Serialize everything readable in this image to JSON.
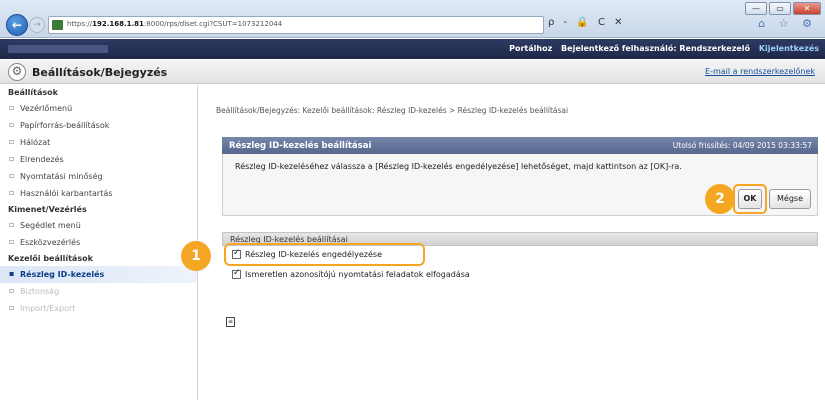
{
  "browser": {
    "url_prefix": "https://",
    "url_host": "192.168.1.81",
    "url_rest": ":8000/rps/dlset.cgi?CSUT=1073212044",
    "search_tools": "ρ - 🔒 C ✕",
    "window_controls": [
      "—",
      "▭",
      "✕"
    ],
    "toolbar_icons": "⌂ ☆ ⚙"
  },
  "header": {
    "links": [
      "Portálhoz",
      "Bejelentkező felhasználó: Rendszerkezelő"
    ],
    "logout": "Kijelentkezés"
  },
  "title": {
    "text": "Beállítások/Bejegyzés",
    "mail_link": "E-mail a rendszerkezelőnek"
  },
  "sidebar": {
    "sections": [
      {
        "heading": "Beállítások",
        "items": [
          {
            "label": "Vezérlőmenü"
          },
          {
            "label": "Papírforrás-beállítások"
          },
          {
            "label": "Hálózat"
          },
          {
            "label": "Elrendezés"
          },
          {
            "label": "Nyomtatási minőség"
          },
          {
            "label": "Használói karbantartás"
          }
        ]
      },
      {
        "heading": "Kimenet/Vezérlés",
        "items": [
          {
            "label": "Segédlet menü"
          },
          {
            "label": "Eszközvezérlés"
          }
        ]
      },
      {
        "heading": "Kezelői beállítások",
        "items": [
          {
            "label": "Részleg ID-kezelés",
            "active": true
          },
          {
            "label": "Biztonság",
            "faded": true
          },
          {
            "label": "Import/Export",
            "faded": true
          }
        ]
      }
    ]
  },
  "main": {
    "breadcrumb": "Beállítások/Bejegyzés: Kezelői beállítások: Részleg ID-kezelés > Részleg ID-kezelés beállításai",
    "panel_title": "Részleg ID-kezelés beállításai",
    "last_update": "Utolsó frissítés: 04/09 2015 03:33:57",
    "instruction": "Részleg ID-kezeléséhez válassza a [Részleg ID-kezelés engedélyezése] lehetőséget, majd kattintson az [OK]-ra.",
    "ok_label": "OK",
    "cancel_label": "Mégse",
    "section_title": "Részleg ID-kezelés beállításai",
    "options": [
      {
        "label": "Részleg ID-kezelés engedélyezése",
        "checked": true
      },
      {
        "label": "Ismeretlen azonosítójú nyomtatási feladatok elfogadása",
        "checked": true
      }
    ]
  },
  "callouts": {
    "step1": "1",
    "step2": "2",
    "color": "#f5a623"
  }
}
